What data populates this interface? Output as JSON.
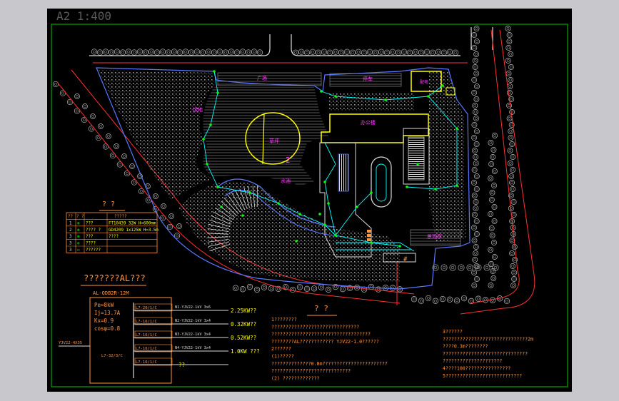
{
  "sheet": {
    "label": "A2   1:400"
  },
  "site_labels": {
    "lawn": "草坪",
    "office": "办公楼",
    "garden_a": "绿地",
    "garden_b": "广场",
    "east_block": "配电",
    "parking": "停车",
    "plaza": "水池",
    "south_block": "景观亭",
    "marker_2": "2",
    "marker_h": "#"
  },
  "legend": {
    "title": "? ?",
    "headers": [
      "??",
      "? ?",
      "?????"
    ],
    "rows": [
      {
        "no": "1",
        "symbol": "⊗",
        "name": "???",
        "spec": "FT10439  32W H=600mm"
      },
      {
        "no": "2",
        "symbol": "⊗",
        "name": "???? ?",
        "spec": "GD4209 1x125W H=3.5m"
      },
      {
        "no": "3",
        "symbol": "⊗",
        "name": "???",
        "spec": "????"
      },
      {
        "no": "3",
        "symbol": "⊘",
        "name": "????",
        "spec": ""
      },
      {
        "no": "3",
        "symbol": "▭",
        "name": "??????",
        "spec": ""
      }
    ]
  },
  "panel": {
    "title": "???????AL???",
    "id": "AL-QDB2R-12M",
    "params": [
      "Pe=8kW",
      "Ij=13.7A",
      "Kx=0.9",
      "cosφ=0.8"
    ],
    "feeder_left": "YJV22-4X35",
    "main_breaker": "L7-32/3/C",
    "circuits": [
      {
        "breaker": "L7-20/1/C",
        "cable": "N1-YJV22-1kV 3x6",
        "load": "2.25KW??"
      },
      {
        "breaker": "L7-16/1/C",
        "cable": "N2-YJV22-1kV 3x4",
        "load": "0.32KW??"
      },
      {
        "breaker": "L7-16/1/C",
        "cable": "N3-YJV22-1kV 3x4",
        "load": "0.52KW??"
      },
      {
        "breaker": "L7-16/1/C",
        "cable": "N4-YJV22-1kV 3x4",
        "load": "1.0KW ???"
      },
      {
        "breaker": "L7-16/1/C",
        "cable": "",
        "load": "??"
      }
    ]
  },
  "notes": {
    "title": "? ?",
    "col1": [
      "1????????",
      "  ???????????????????????????????",
      "  ???????????????????????????????????",
      "  ????????AL???????????? YJV22-1.0??????",
      "2??????",
      "  (1)?????",
      "    ??????????????0.8m???????????????????????",
      "    ????????????????????????????",
      "  (2)  ?????????????"
    ],
    "col2": [
      "3??????",
      "  ??????????????????????????????2m",
      "  ????0.3m????????",
      "  ??????????????????????????????",
      "  ?????????????????????",
      "4????100????????????????",
      "5???????????????????????????"
    ]
  },
  "colors": {
    "green_frame": "#00c800",
    "white": "#ffffff",
    "yellow": "#ffff00",
    "magenta": "#ff3cff",
    "cyan": "#00ffff",
    "red": "#ff3030",
    "blue": "#5a78ff",
    "orange": "#ff9640",
    "green": "#00ff00"
  }
}
